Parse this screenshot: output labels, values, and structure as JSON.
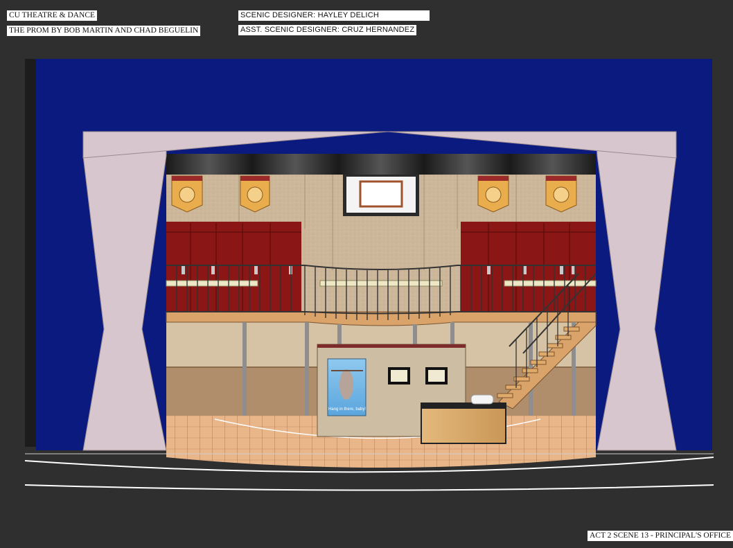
{
  "title_block": {
    "company": "CU THEATRE & DANCE",
    "production": "THE PROM BY BOB MARTIN AND CHAD BEGUELIN",
    "designer": "SCENIC DESIGNER: HAYLEY DELICH",
    "assistant": "ASST. SCENIC DESIGNER: CRUZ HERNANDEZ",
    "scene": "ACT 2 SCENE 13 - PRINCIPAL'S OFFICE"
  },
  "poster": {
    "caption": "Hang in there, baby!"
  },
  "colors": {
    "background": "#2f2f2f",
    "main_drape": "#0b1a7e",
    "legs": "#d7c6cd",
    "lockers": "#8a1616",
    "wall": "#cdb79a",
    "floor": "#e7b489",
    "banner": "#e9ad4d"
  }
}
